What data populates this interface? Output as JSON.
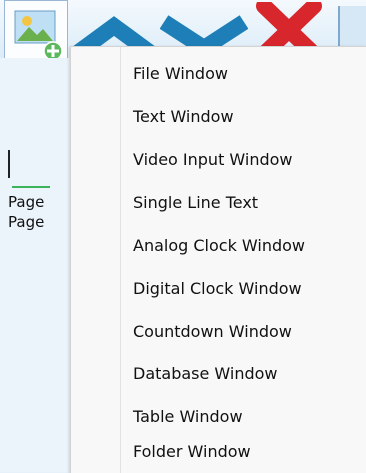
{
  "toolbar": {
    "buttons": [
      {
        "icon": "add-image-icon"
      },
      {
        "icon": "chevron-up-icon"
      },
      {
        "icon": "chevron-down-icon"
      },
      {
        "icon": "delete-x-icon"
      }
    ],
    "colors": {
      "arrow": "#1e7fb8",
      "delete": "#d7262c",
      "add_badge": "#5cb85c"
    }
  },
  "left_panel": {
    "items": [
      "Page",
      "Page"
    ]
  },
  "context_menu": {
    "items": [
      "File Window",
      "Text Window",
      "Video Input Window",
      "Single Line Text",
      "Analog Clock Window",
      "Digital Clock Window",
      "Countdown Window",
      "Database Window",
      "Table Window",
      "Folder Window"
    ]
  }
}
